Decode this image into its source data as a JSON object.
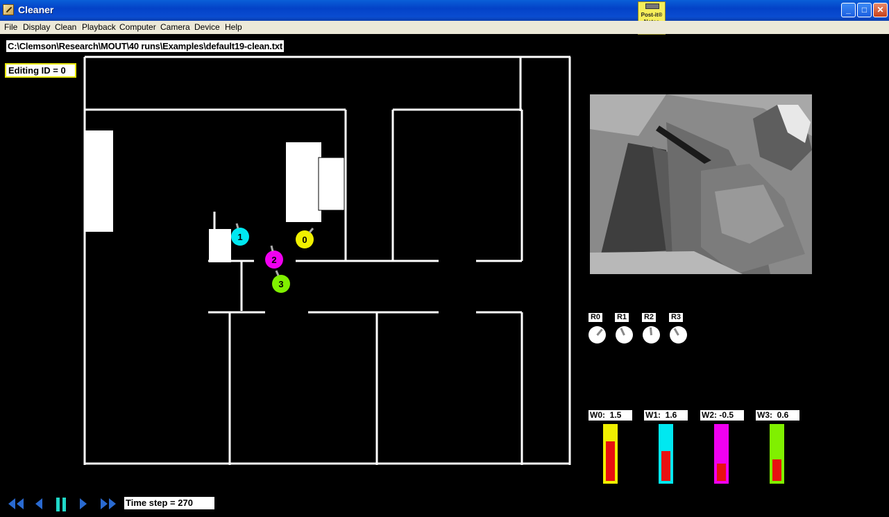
{
  "window": {
    "title": "Cleaner",
    "minimize": "_",
    "maximize": "□",
    "close": "✕"
  },
  "postit": {
    "label_line1": "Post-it®",
    "label_line2": "Notes"
  },
  "menu": [
    "File",
    "Display",
    "Clean",
    "Playback",
    "Computer",
    "Camera",
    "Device",
    "Help"
  ],
  "file_path": "C:\\Clemson\\Research\\MOUT\\40 runs\\Examples\\default19-clean.txt",
  "editing_id": "Editing ID = 0",
  "robots": [
    {
      "id": "0",
      "color": "#f0f000"
    },
    {
      "id": "1",
      "color": "#00e8f0"
    },
    {
      "id": "2",
      "color": "#f000f0"
    },
    {
      "id": "3",
      "color": "#80f000"
    }
  ],
  "radios": [
    {
      "label": "R0",
      "angle": 40
    },
    {
      "label": "R1",
      "angle": -25
    },
    {
      "label": "R2",
      "angle": -5
    },
    {
      "label": "R3",
      "angle": -30
    }
  ],
  "weights": [
    {
      "label": "W0:  1.5",
      "value": 1.5,
      "color": "#f0f000",
      "fill_fraction": 0.7
    },
    {
      "label": "W1:  1.6",
      "value": 1.6,
      "color": "#00e8f0",
      "fill_fraction": 0.53
    },
    {
      "label": "W2: -0.5",
      "value": -0.5,
      "color": "#f000f0",
      "fill_fraction": 0.3
    },
    {
      "label": "W3:  0.6",
      "value": 0.6,
      "color": "#80f000",
      "fill_fraction": 0.38
    }
  ],
  "time_step": "Time step = 270",
  "icons": {
    "rewind": "rewind-icon",
    "step_back": "step-back-icon",
    "pause": "pause-icon",
    "step_forward": "step-forward-icon",
    "fast_forward": "fast-forward-icon"
  },
  "colors": {
    "titlebar": "#0342c8",
    "menubar": "#ece9d8",
    "playback": "#2a6ad0",
    "pause": "#20d8c8"
  }
}
